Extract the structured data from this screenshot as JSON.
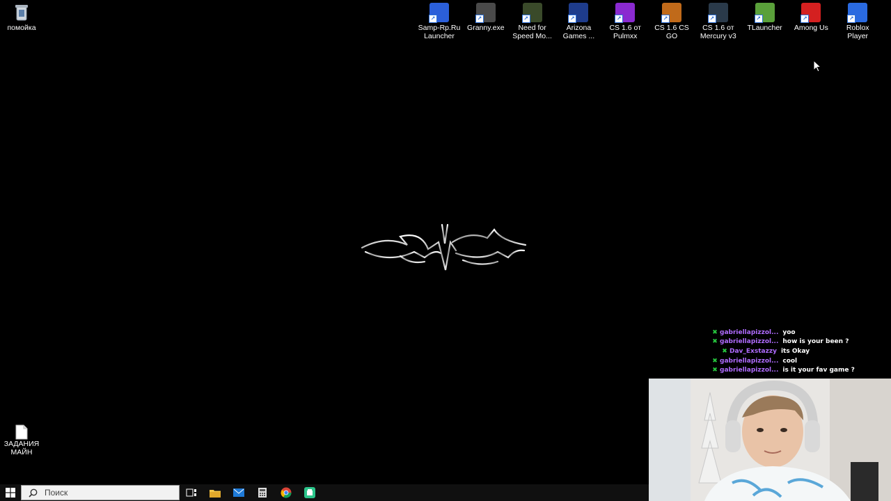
{
  "desktop": {
    "recycle_bin": {
      "label": "помойка",
      "icon": "recycle-bin-icon"
    },
    "shortcuts": [
      {
        "label": "Samp-Rp.Ru\nLauncher",
        "icon": "samp-icon",
        "color": "#2b5fd9"
      },
      {
        "label": "Granny.exe",
        "icon": "granny-icon",
        "color": "#4a4a4a"
      },
      {
        "label": "Need for\nSpeed Mo...",
        "icon": "nfs-icon",
        "color": "#3a4a2a"
      },
      {
        "label": "Arizona\nGames ...",
        "icon": "arizona-icon",
        "color": "#1e3c8c"
      },
      {
        "label": "CS 1.6 от\nPulmxx",
        "icon": "cs-pulmxx-icon",
        "color": "#8a2ad0"
      },
      {
        "label": "CS 1.6 CS GO",
        "icon": "cs-csgo-icon",
        "color": "#c06a1a"
      },
      {
        "label": "CS 1.6 от\nMercury v3",
        "icon": "cs-mercury-icon",
        "color": "#2a3a4a"
      },
      {
        "label": "TLauncher",
        "icon": "tlauncher-icon",
        "color": "#5aa03a"
      },
      {
        "label": "Among Us",
        "icon": "among-us-icon",
        "color": "#d42020"
      },
      {
        "label": "Roblox\nPlayer",
        "icon": "roblox-icon",
        "color": "#2a6ae0"
      }
    ],
    "bottom_file": {
      "label": "ЗАДАНИЯ\nМАЙН",
      "icon": "document-icon"
    }
  },
  "chat": {
    "messages": [
      {
        "user": "gabriellapizzol...",
        "text": "yoo",
        "badge": "mod-sword-icon"
      },
      {
        "user": "gabriellapizzol...",
        "text": "how is your been ?",
        "badge": "mod-sword-icon"
      },
      {
        "user": "Dav_Exstazzy",
        "text": "its Okay",
        "badge": "mod-sword-icon"
      },
      {
        "user": "gabriellapizzol...",
        "text": "cool",
        "badge": "mod-sword-icon"
      },
      {
        "user": "gabriellapizzol...",
        "text": "is it your fav game ?",
        "badge": "mod-sword-icon"
      }
    ]
  },
  "taskbar": {
    "search_placeholder": "Поиск",
    "apps": [
      "task-view-icon",
      "file-explorer-icon",
      "mail-icon",
      "calculator-icon",
      "chrome-icon",
      "app-icon"
    ]
  },
  "colors": {
    "chat_user": "#b06cff",
    "chat_badge": "#27c93f",
    "taskbar": "#101010"
  }
}
